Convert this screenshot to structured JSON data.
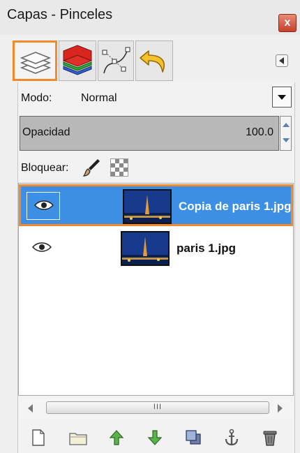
{
  "window": {
    "title": "Capas - Pinceles",
    "close_glyph": "x"
  },
  "tabs": [
    {
      "name": "layers",
      "icon": "layers-icon",
      "selected": true
    },
    {
      "name": "channels",
      "icon": "channels-icon",
      "selected": false
    },
    {
      "name": "paths",
      "icon": "paths-icon",
      "selected": false
    },
    {
      "name": "undo",
      "icon": "undo-icon",
      "selected": false
    }
  ],
  "mode": {
    "label": "Modo:",
    "value": "Normal"
  },
  "opacity": {
    "label": "Opacidad",
    "value": "100.0"
  },
  "lock": {
    "label": "Bloquear:"
  },
  "layers": [
    {
      "name": "Copia de paris 1.jpg",
      "visible": true,
      "selected": true
    },
    {
      "name": "paris 1.jpg",
      "visible": true,
      "selected": false
    }
  ],
  "scrollbar": {
    "grip": "III"
  },
  "toolbar": [
    {
      "icon": "new-layer-icon"
    },
    {
      "icon": "new-group-icon"
    },
    {
      "icon": "raise-layer-icon"
    },
    {
      "icon": "lower-layer-icon"
    },
    {
      "icon": "duplicate-layer-icon"
    },
    {
      "icon": "anchor-layer-icon"
    },
    {
      "icon": "delete-layer-icon"
    }
  ],
  "colors": {
    "selection": "#3d8fe6",
    "highlight": "#f28a2c"
  }
}
